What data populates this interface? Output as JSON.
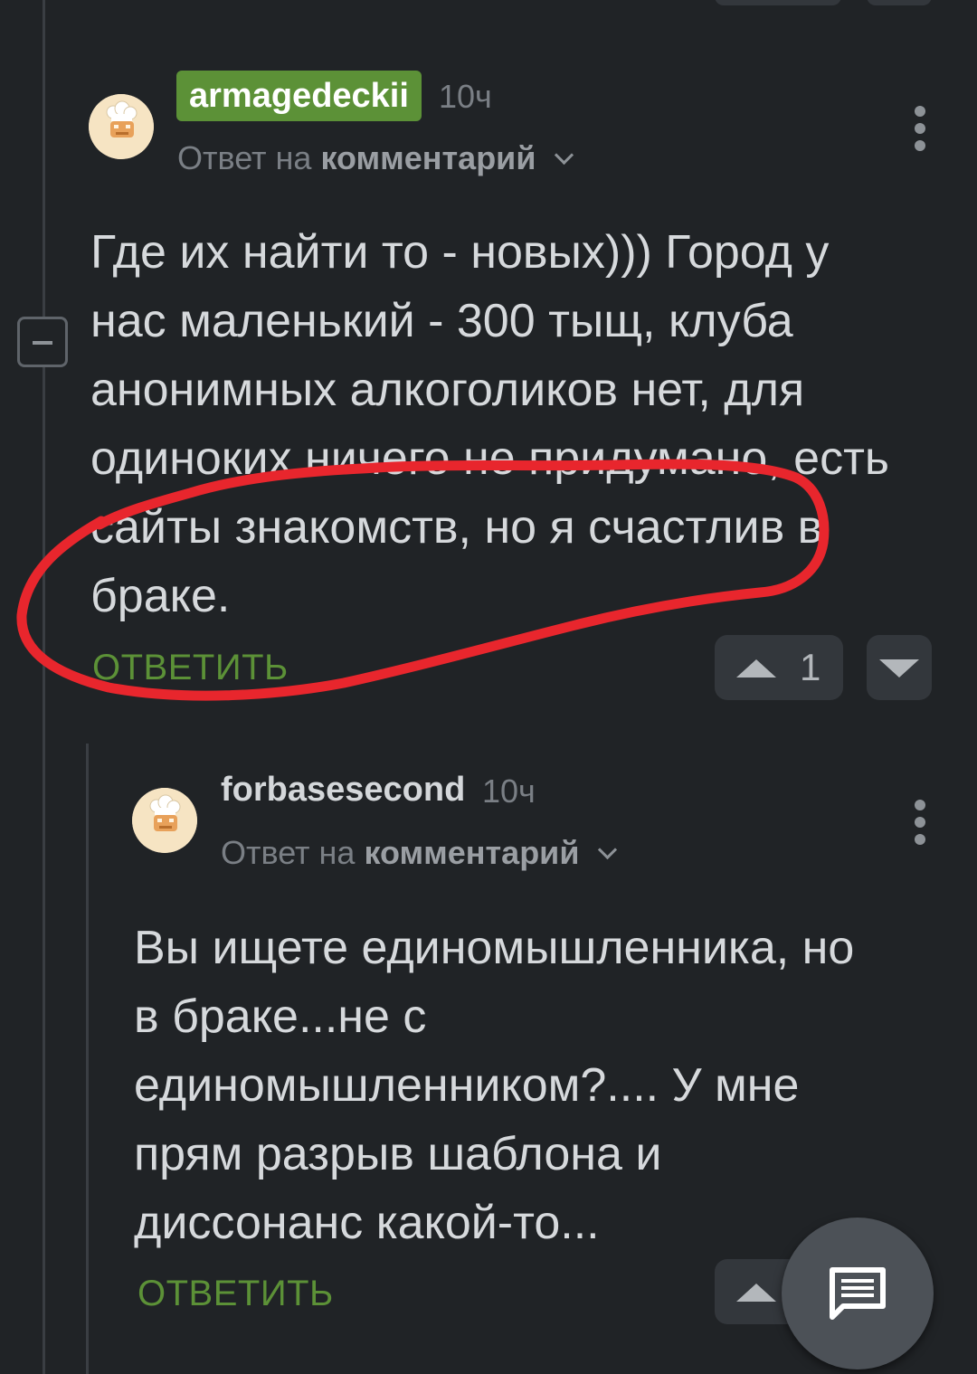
{
  "comment1": {
    "username": "armagedeckii",
    "time": "10ч",
    "reply_prefix": "Ответ на",
    "reply_target": "комментарий",
    "text": "Где их найти то - новых))) Город у нас маленький - 300 тыщ, клуба анонимных алкоголиков нет, для одиноких ничего не придумано, есть сайты знакомств, но я счастлив в браке.",
    "reply_label": "ОТВЕТИТЬ",
    "votes": "1"
  },
  "comment2": {
    "username": "forbasesecond",
    "time": "10ч",
    "reply_prefix": "Ответ на",
    "reply_target": "комментарий",
    "text": "Вы ищете единомышленника, но в браке...не с единомышленником?.... У мне прям разрыв шаблона и диссонанс какой-то...",
    "reply_label": "ОТВЕТИТЬ"
  },
  "colors": {
    "background": "#202326",
    "accent_green": "#5c9137",
    "annotation_red": "#e8262d",
    "text": "#d6d9dc",
    "muted": "#7a7f85"
  },
  "icons": {
    "collapse": "minus-square-icon",
    "more": "vertical-dots-icon",
    "upvote": "triangle-up-icon",
    "downvote": "triangle-down-icon",
    "chevron": "chevron-down-icon",
    "fab": "comment-icon",
    "avatar": "chef-hat-avatar"
  }
}
